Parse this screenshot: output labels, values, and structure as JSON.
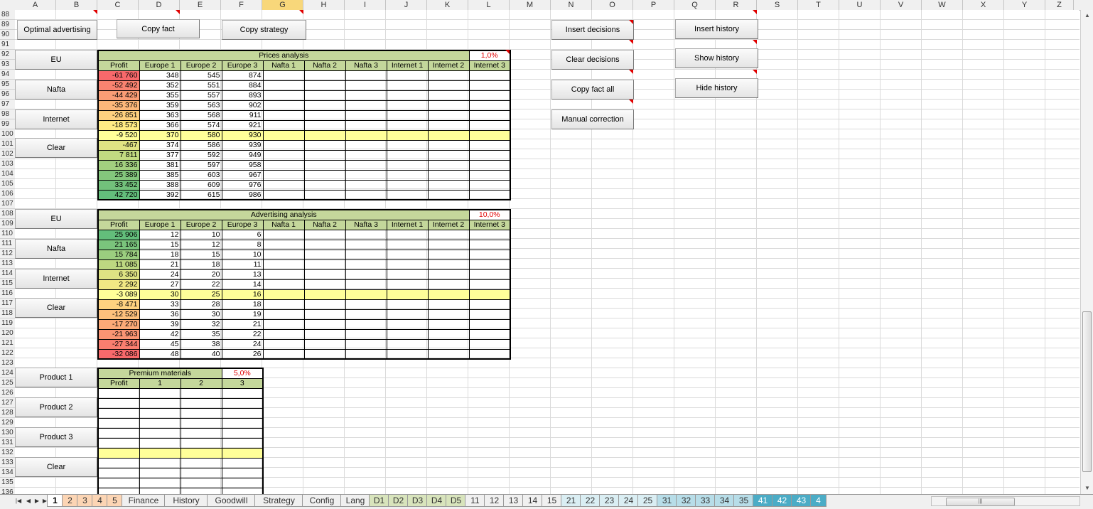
{
  "columns": [
    "A",
    "B",
    "C",
    "D",
    "E",
    "F",
    "G",
    "H",
    "I",
    "J",
    "K",
    "L",
    "M",
    "N",
    "O",
    "P",
    "Q",
    "R",
    "S",
    "T",
    "U",
    "V",
    "W",
    "X",
    "Y",
    "Z"
  ],
  "selected_column": "G",
  "rows": [
    "88",
    "89",
    "90",
    "91",
    "92",
    "93",
    "94",
    "95",
    "96",
    "97",
    "98",
    "99",
    "100",
    "101",
    "102",
    "103",
    "104",
    "105",
    "106",
    "107",
    "108",
    "109",
    "110",
    "111",
    "112",
    "113",
    "114",
    "115",
    "116",
    "117",
    "118",
    "119",
    "120",
    "121",
    "122",
    "123",
    "124",
    "125",
    "126",
    "127",
    "128",
    "129",
    "130",
    "131",
    "132",
    "133",
    "134",
    "135",
    "136"
  ],
  "buttons": {
    "optimal_advertising": "Optimal advertising",
    "copy_fact": "Copy fact",
    "copy_strategy": "Copy strategy",
    "insert_decisions": "Insert decisions",
    "clear_decisions": "Clear decisions",
    "copy_fact_all": "Copy fact all",
    "manual_correction": "Manual correction",
    "insert_history": "Insert history",
    "show_history": "Show history",
    "hide_history": "Hide history",
    "prices_eu": "EU",
    "prices_nafta": "Nafta",
    "prices_internet": "Internet",
    "prices_clear": "Clear",
    "adv_eu": "EU",
    "adv_nafta": "Nafta",
    "adv_internet": "Internet",
    "adv_clear": "Clear",
    "product_1": "Product 1",
    "product_2": "Product 2",
    "product_3": "Product 3",
    "premium_clear": "Clear"
  },
  "prices_analysis": {
    "title": "Prices analysis",
    "pct": "1,0%",
    "headers": [
      "Profit",
      "Europe 1",
      "Europe 2",
      "Europe 3",
      "Nafta 1",
      "Nafta 2",
      "Nafta 3",
      "Internet 1",
      "Internet 2",
      "Internet 3"
    ],
    "highlight_row": 6,
    "rows": [
      [
        "-61 760",
        "348",
        "545",
        "874",
        "",
        "",
        "",
        "",
        "",
        ""
      ],
      [
        "-52 492",
        "352",
        "551",
        "884",
        "",
        "",
        "",
        "",
        "",
        ""
      ],
      [
        "-44 429",
        "355",
        "557",
        "893",
        "",
        "",
        "",
        "",
        "",
        ""
      ],
      [
        "-35 376",
        "359",
        "563",
        "902",
        "",
        "",
        "",
        "",
        "",
        ""
      ],
      [
        "-26 851",
        "363",
        "568",
        "911",
        "",
        "",
        "",
        "",
        "",
        ""
      ],
      [
        "-18 573",
        "366",
        "574",
        "921",
        "",
        "",
        "",
        "",
        "",
        ""
      ],
      [
        "-9 520",
        "370",
        "580",
        "930",
        "",
        "",
        "",
        "",
        "",
        ""
      ],
      [
        "-467",
        "374",
        "586",
        "939",
        "",
        "",
        "",
        "",
        "",
        ""
      ],
      [
        "7 811",
        "377",
        "592",
        "949",
        "",
        "",
        "",
        "",
        "",
        ""
      ],
      [
        "16 336",
        "381",
        "597",
        "958",
        "",
        "",
        "",
        "",
        "",
        ""
      ],
      [
        "25 389",
        "385",
        "603",
        "967",
        "",
        "",
        "",
        "",
        "",
        ""
      ],
      [
        "33 452",
        "388",
        "609",
        "976",
        "",
        "",
        "",
        "",
        "",
        ""
      ],
      [
        "42 720",
        "392",
        "615",
        "986",
        "",
        "",
        "",
        "",
        "",
        ""
      ]
    ],
    "profit_colors": [
      "#f8696b",
      "#f98370",
      "#fa9d75",
      "#fcb77a",
      "#fdd17f",
      "#ffeb84",
      "#ffff99",
      "#e0e383",
      "#c1da81",
      "#a2d07f",
      "#84c77c",
      "#72c17b",
      "#63be7b"
    ]
  },
  "advertising_analysis": {
    "title": "Advertising analysis",
    "pct": "10,0%",
    "headers": [
      "Profit",
      "Europe 1",
      "Europe 2",
      "Europe 3",
      "Nafta 1",
      "Nafta 2",
      "Nafta 3",
      "Internet 1",
      "Internet 2",
      "Internet 3"
    ],
    "highlight_row": 6,
    "rows": [
      [
        "25 906",
        "12",
        "10",
        "6",
        "",
        "",
        "",
        "",
        "",
        ""
      ],
      [
        "21 165",
        "15",
        "12",
        "8",
        "",
        "",
        "",
        "",
        "",
        ""
      ],
      [
        "15 784",
        "18",
        "15",
        "10",
        "",
        "",
        "",
        "",
        "",
        ""
      ],
      [
        "11 085",
        "21",
        "18",
        "11",
        "",
        "",
        "",
        "",
        "",
        ""
      ],
      [
        "6 350",
        "24",
        "20",
        "13",
        "",
        "",
        "",
        "",
        "",
        ""
      ],
      [
        "2 292",
        "27",
        "22",
        "14",
        "",
        "",
        "",
        "",
        "",
        ""
      ],
      [
        "-3 089",
        "30",
        "25",
        "16",
        "",
        "",
        "",
        "",
        "",
        ""
      ],
      [
        "-8 471",
        "33",
        "28",
        "18",
        "",
        "",
        "",
        "",
        "",
        ""
      ],
      [
        "-12 529",
        "36",
        "30",
        "19",
        "",
        "",
        "",
        "",
        "",
        ""
      ],
      [
        "-17 270",
        "39",
        "32",
        "21",
        "",
        "",
        "",
        "",
        "",
        ""
      ],
      [
        "-21 963",
        "42",
        "35",
        "22",
        "",
        "",
        "",
        "",
        "",
        ""
      ],
      [
        "-27 344",
        "45",
        "38",
        "24",
        "",
        "",
        "",
        "",
        "",
        ""
      ],
      [
        "-32 086",
        "48",
        "40",
        "26",
        "",
        "",
        "",
        "",
        "",
        ""
      ]
    ],
    "profit_colors": [
      "#63be7b",
      "#7ac47c",
      "#9bce7f",
      "#bdd881",
      "#dee283",
      "#f1e784",
      "#ffff99",
      "#fed280",
      "#fdc07c",
      "#fca977",
      "#fa9473",
      "#f97e6f",
      "#f8696b"
    ]
  },
  "premium_materials": {
    "title": "Premium materials",
    "pct": "5,0%",
    "headers": [
      "Profit",
      "1",
      "2",
      "3"
    ],
    "highlight_row": 6,
    "rows": [
      [
        "",
        "",
        "",
        ""
      ],
      [
        "",
        "",
        "",
        ""
      ],
      [
        "",
        "",
        "",
        ""
      ],
      [
        "",
        "",
        "",
        ""
      ],
      [
        "",
        "",
        "",
        ""
      ],
      [
        "",
        "",
        "",
        ""
      ],
      [
        "",
        "",
        "",
        ""
      ],
      [
        "",
        "",
        "",
        ""
      ],
      [
        "",
        "",
        "",
        ""
      ],
      [
        "",
        "",
        "",
        ""
      ],
      [
        "",
        "",
        "",
        ""
      ]
    ]
  },
  "sheet_tabs": [
    {
      "label": "1",
      "color": "#ffffff"
    },
    {
      "label": "2",
      "color": "#fcd5b4"
    },
    {
      "label": "3",
      "color": "#fcd5b4"
    },
    {
      "label": "4",
      "color": "#fcd5b4"
    },
    {
      "label": "5",
      "color": "#fcd5b4"
    },
    {
      "label": "Finance",
      "color": "#f0f0f0"
    },
    {
      "label": "History",
      "color": "#f0f0f0"
    },
    {
      "label": "Goodwill",
      "color": "#f0f0f0"
    },
    {
      "label": "Strategy",
      "color": "#f0f0f0"
    },
    {
      "label": "Config",
      "color": "#f0f0f0"
    },
    {
      "label": "Lang",
      "color": "#f0f0f0"
    },
    {
      "label": "D1",
      "color": "#d8e4bc"
    },
    {
      "label": "D2",
      "color": "#d8e4bc"
    },
    {
      "label": "D3",
      "color": "#d8e4bc"
    },
    {
      "label": "D4",
      "color": "#d8e4bc"
    },
    {
      "label": "D5",
      "color": "#d8e4bc"
    },
    {
      "label": "11",
      "color": "#f0f0f0"
    },
    {
      "label": "12",
      "color": "#f0f0f0"
    },
    {
      "label": "13",
      "color": "#f0f0f0"
    },
    {
      "label": "14",
      "color": "#f0f0f0"
    },
    {
      "label": "15",
      "color": "#f0f0f0"
    },
    {
      "label": "21",
      "color": "#daeef3"
    },
    {
      "label": "22",
      "color": "#daeef3"
    },
    {
      "label": "23",
      "color": "#daeef3"
    },
    {
      "label": "24",
      "color": "#daeef3"
    },
    {
      "label": "25",
      "color": "#daeef3"
    },
    {
      "label": "31",
      "color": "#b7dde8"
    },
    {
      "label": "32",
      "color": "#b7dde8"
    },
    {
      "label": "33",
      "color": "#b7dde8"
    },
    {
      "label": "34",
      "color": "#b7dde8"
    },
    {
      "label": "35",
      "color": "#b7dde8"
    },
    {
      "label": "41",
      "color": "#4bacc6"
    },
    {
      "label": "42",
      "color": "#4bacc6"
    },
    {
      "label": "43",
      "color": "#4bacc6"
    },
    {
      "label": "4",
      "color": "#4bacc6"
    }
  ]
}
